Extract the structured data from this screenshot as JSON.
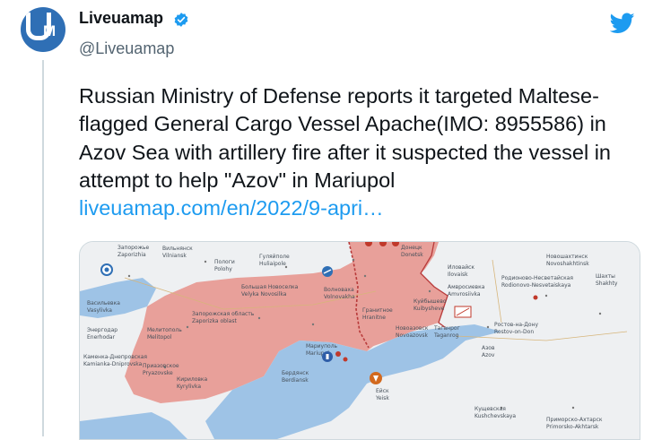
{
  "tweet": {
    "author_name": "Liveuamap",
    "author_handle": "@Liveuamap",
    "text": "Russian Ministry of Defense reports it targeted Maltese-flagged General Cargo Vessel Apache(IMO: 8955586) in Azov Sea with artillery fire after it suspected the vessel in attempt to help \"Azov\" in Mariupol",
    "link": "liveuamap.com/en/2022/9-apri…"
  },
  "icons": {
    "verified": "verified-badge-icon",
    "platform": "twitter-bird-icon"
  },
  "colors": {
    "link": "#1d9bf0",
    "avatar_bg": "#2f6fb5",
    "occupied": "#e8a09a",
    "sea": "#9ec3e6",
    "verified": "#1d9bf0"
  },
  "map": {
    "labels": [
      "Запорожье",
      "Zaporizhia",
      "Вильнянск",
      "Vilniansk",
      "Пологи",
      "Polohy",
      "Гуляйполе",
      "Huliaipole",
      "Волноваха",
      "Volnovakha",
      "Гранитное",
      "Hranitne",
      "Мелитополь",
      "Melitopol",
      "Бердянск",
      "Berdiansk",
      "Мариуполь",
      "Mariupol",
      "Новоазовск",
      "Novoazovsk",
      "Таганрог",
      "Taganrog",
      "Ростов-на-Дону",
      "Rostov-on-Don",
      "Азов",
      "Azov",
      "Ейск",
      "Yeisk",
      "Кущевская",
      "Kushchevskaya",
      "Приморско-Ахтарск",
      "Primorsko-Akhtarsk",
      "Кириловка",
      "Kyrylivka",
      "Приазовское",
      "Pryazovske",
      "Васильевка",
      "Vasylivka",
      "Энергодар",
      "Enerhodar",
      "Каменка-Днепровская",
      "Kamianka-Dniprovska",
      "Донецк",
      "Donetsk",
      "Иловайск",
      "Ilovaisk",
      "Амвросиевка",
      "Amvrosiivka",
      "Куйбышево",
      "Kuibysheve",
      "Родионово-Несветайская",
      "Rodionovo-Nesvetaiskaya",
      "Новошахтинск",
      "Novoshakhtinsk",
      "Шахты",
      "Shakhty",
      "Большая Новоселка",
      "Velyka Novosilka",
      "Запорожская область",
      "Zaporizka oblast"
    ]
  }
}
